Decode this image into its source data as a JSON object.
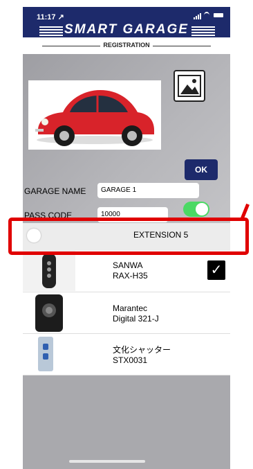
{
  "status_bar": {
    "time": "11:17 ↗"
  },
  "header": {
    "app_title": "SMART GARAGE",
    "section_title": "REGISTRATION"
  },
  "car": {
    "image": "red-vw-beetle"
  },
  "photo_button": {
    "icon": "image-icon"
  },
  "buttons": {
    "ok_label": "OK"
  },
  "form": {
    "garage_name_label": "GARAGE NAME",
    "garage_name_value": "GARAGE 1",
    "pass_code_label": "PASS CODE",
    "pass_code_value": "10000",
    "pass_code_toggle_on": true
  },
  "extension": {
    "label": "EXTENSION 5",
    "toggle_on": false
  },
  "remotes": [
    {
      "brand": "SANWA",
      "model": "RAX-H35",
      "selected": true
    },
    {
      "brand": "Marantec",
      "model": "Digital 321-J",
      "selected": false
    },
    {
      "brand": "文化シャッター",
      "model": "STX0031",
      "selected": false
    }
  ],
  "colors": {
    "header_navy": "#1d2a6b",
    "toggle_green": "#4bd964",
    "highlight_red": "#e00000",
    "car_red": "#d8232a"
  }
}
